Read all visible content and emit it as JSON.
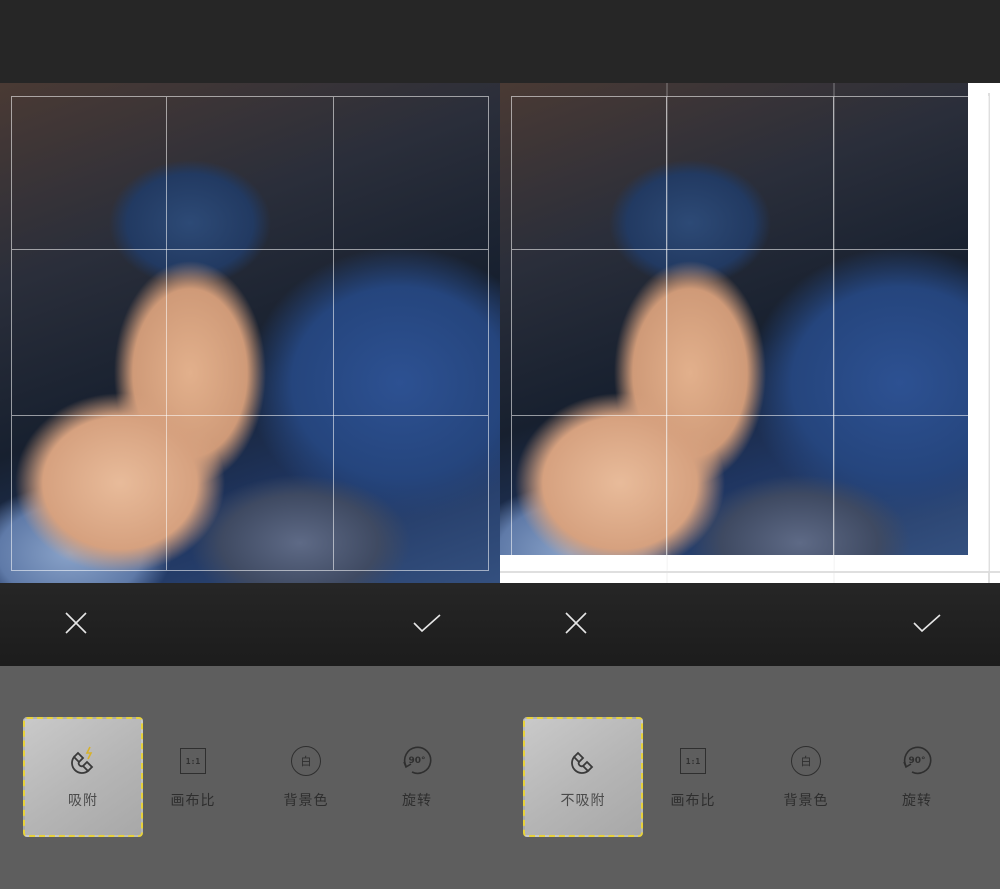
{
  "panels": [
    {
      "id": "left",
      "actions": {
        "cancel_icon": "close-icon",
        "confirm_icon": "check-icon"
      },
      "tools": [
        {
          "label": "吸附",
          "icon": "magnet-icon",
          "active": true
        },
        {
          "label": "画布比",
          "icon": "ratio-icon",
          "badge": "1:1",
          "active": false
        },
        {
          "label": "背景色",
          "icon": "background-color-icon",
          "badge": "白",
          "active": false
        },
        {
          "label": "旋转",
          "icon": "rotate-icon",
          "badge": "90°",
          "active": false
        }
      ]
    },
    {
      "id": "right",
      "actions": {
        "cancel_icon": "close-icon",
        "confirm_icon": "check-icon"
      },
      "tools": [
        {
          "label": "不吸附",
          "icon": "magnet-off-icon",
          "active": true
        },
        {
          "label": "画布比",
          "icon": "ratio-icon",
          "badge": "1:1",
          "active": false
        },
        {
          "label": "背景色",
          "icon": "background-color-icon",
          "badge": "白",
          "active": false
        },
        {
          "label": "旋转",
          "icon": "rotate-icon",
          "badge": "90°",
          "active": false
        }
      ]
    }
  ],
  "colors": {
    "background": "#262626",
    "toolbar": "#5e5e5e",
    "active_border": "#e7d23a",
    "magnet_accent": "#d8b22a"
  }
}
